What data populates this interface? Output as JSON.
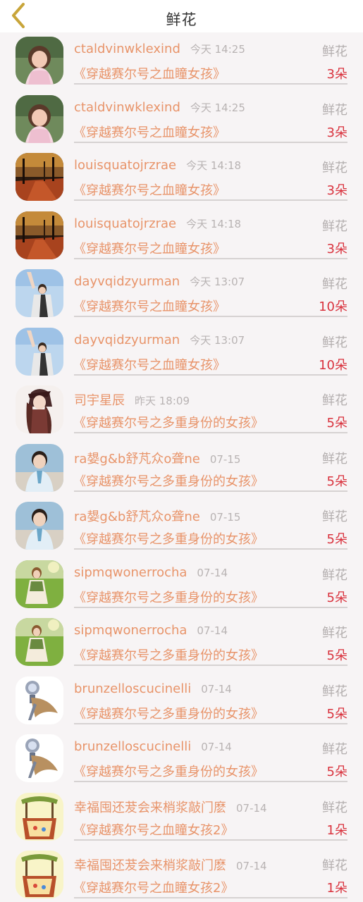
{
  "header": {
    "title": "鲜花",
    "back_icon": "chevron-left-icon",
    "back_color": "#c8a53a"
  },
  "colors": {
    "name": "#e8946a",
    "count": "#d9323d",
    "meta": "#b8b3b3"
  },
  "items": [
    {
      "avatar": "girl-photo",
      "name": "ctaldvinwklexind",
      "time": "今天 14:25",
      "type": "鲜花",
      "book": "《穿越赛尔号之血瞳女孩》",
      "count": "3朵"
    },
    {
      "avatar": "girl-photo",
      "name": "ctaldvinwklexind",
      "time": "今天 14:25",
      "type": "鲜花",
      "book": "《穿越赛尔号之血瞳女孩》",
      "count": "3朵"
    },
    {
      "avatar": "autumn-path",
      "name": "louisquatojrzrae",
      "time": "今天 14:18",
      "type": "鲜花",
      "book": "《穿越赛尔号之血瞳女孩》",
      "count": "3朵"
    },
    {
      "avatar": "autumn-path",
      "name": "louisquatojrzrae",
      "time": "今天 14:18",
      "type": "鲜花",
      "book": "《穿越赛尔号之血瞳女孩》",
      "count": "3朵"
    },
    {
      "avatar": "man-sky",
      "name": "dayvqidzyurman",
      "time": "今天 13:07",
      "type": "鲜花",
      "book": "《穿越赛尔号之血瞳女孩》",
      "count": "10朵"
    },
    {
      "avatar": "man-sky",
      "name": "dayvqidzyurman",
      "time": "今天 13:07",
      "type": "鲜花",
      "book": "《穿越赛尔号之血瞳女孩》",
      "count": "10朵"
    },
    {
      "avatar": "anime-girl",
      "name": "司宇星辰",
      "time": "昨天 18:09",
      "type": "鲜花",
      "book": "《穿越赛尔号之多重身份的女孩》",
      "count": "5朵"
    },
    {
      "avatar": "boy-photo",
      "name": "ra嫢g&b舒芃众o聋ne",
      "time": "07-15",
      "type": "鲜花",
      "book": "《穿越赛尔号之多重身份的女孩》",
      "count": "5朵"
    },
    {
      "avatar": "boy-photo",
      "name": "ra嫢g&b舒芃众o聋ne",
      "time": "07-15",
      "type": "鲜花",
      "book": "《穿越赛尔号之多重身份的女孩》",
      "count": "5朵"
    },
    {
      "avatar": "girl-field",
      "name": "sipmqwonerrocha",
      "time": "07-14",
      "type": "鲜花",
      "book": "《穿越赛尔号之多重身份的女孩》",
      "count": "5朵"
    },
    {
      "avatar": "girl-field",
      "name": "sipmqwonerrocha",
      "time": "07-14",
      "type": "鲜花",
      "book": "《穿越赛尔号之多重身份的女孩》",
      "count": "5朵"
    },
    {
      "avatar": "robot-cape",
      "name": "brunzelloscucinelli",
      "time": "07-14",
      "type": "鲜花",
      "book": "《穿越赛尔号之多重身份的女孩》",
      "count": "5朵"
    },
    {
      "avatar": "robot-cape",
      "name": "brunzelloscucinelli",
      "time": "07-14",
      "type": "鲜花",
      "book": "《穿越赛尔号之多重身份的女孩》",
      "count": "5朵"
    },
    {
      "avatar": "cartoon-swing",
      "name": "幸福囤还茇会来梢浆敲门麽",
      "time": "07-14",
      "type": "鲜花",
      "book": "《穿越赛尔号之血瞳女孩2》",
      "count": "1朵"
    },
    {
      "avatar": "cartoon-swing",
      "name": "幸福囤还茇会来梢浆敲门麽",
      "time": "07-14",
      "type": "鲜花",
      "book": "《穿越赛尔号之血瞳女孩2》",
      "count": "1朵"
    }
  ]
}
